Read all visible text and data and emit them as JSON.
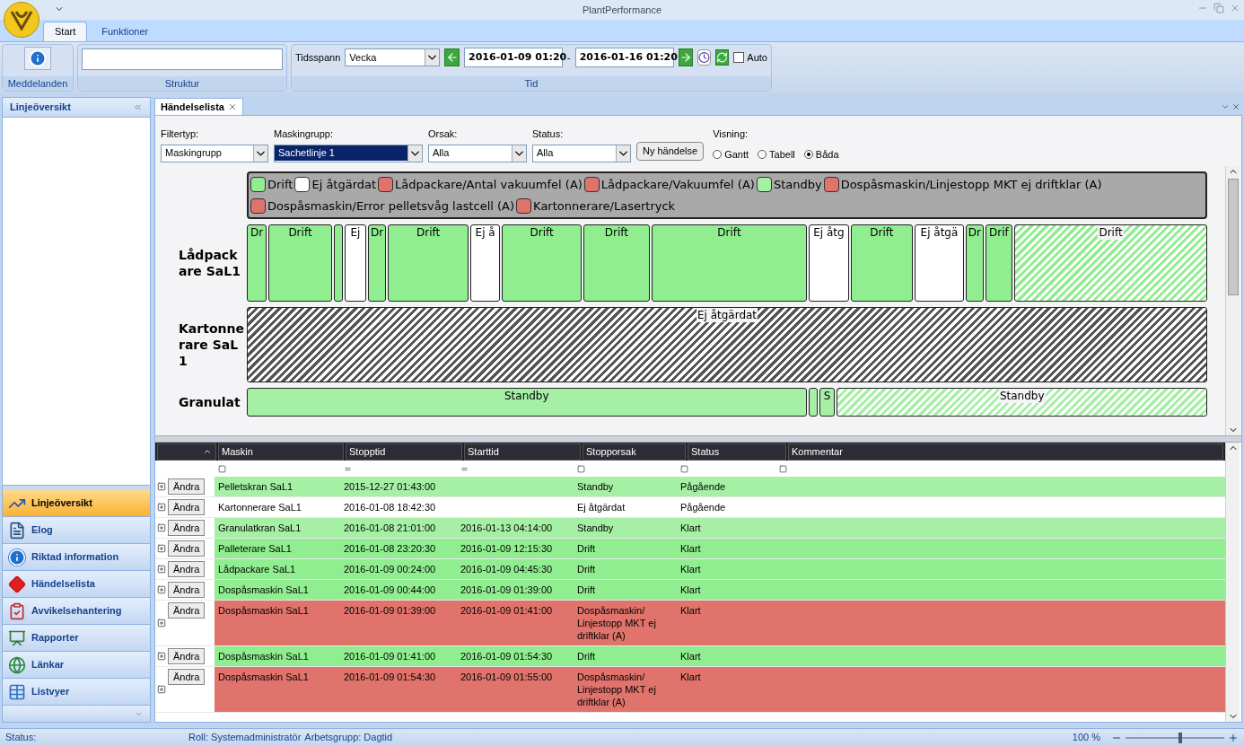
{
  "window": {
    "title": "PlantPerformance"
  },
  "ribbon": {
    "tabs": [
      {
        "label": "Start",
        "selected": true
      },
      {
        "label": "Funktioner",
        "selected": false
      }
    ],
    "messages_button": "Meddelanden",
    "structure_caption": "Struktur",
    "time": {
      "caption": "Tid",
      "span_label": "Tidsspann",
      "span_value": "Vecka",
      "from": "2016-01-09 01:20",
      "separator": "-",
      "to": "2016-01-16 01:20",
      "auto": {
        "label": "Auto",
        "checked": false
      }
    }
  },
  "sidebar": {
    "title": "Linjeöversikt",
    "items": [
      {
        "label": "Linjeöversikt",
        "selected": true
      },
      {
        "label": "Elog",
        "selected": false
      },
      {
        "label": "Riktad information",
        "selected": false
      },
      {
        "label": "Händelselista",
        "selected": false
      },
      {
        "label": "Avvikelsehantering",
        "selected": false
      },
      {
        "label": "Rapporter",
        "selected": false
      },
      {
        "label": "Länkar",
        "selected": false
      },
      {
        "label": "Listvyer",
        "selected": false
      }
    ]
  },
  "document_tab": {
    "label": "Händelselista"
  },
  "filters": [
    {
      "label": "Filtertyp:",
      "value": "Maskingrupp",
      "highlighted": false
    },
    {
      "label": "Maskingrupp:",
      "value": "Sachetlinje 1",
      "highlighted": true
    },
    {
      "label": "Orsak:",
      "value": "Alla",
      "highlighted": false
    },
    {
      "label": "Status:",
      "value": "Alla",
      "highlighted": false
    }
  ],
  "new_event_button": "Ny händelse",
  "view": {
    "label": "Visning:",
    "options": [
      {
        "label": "Gantt",
        "selected": false
      },
      {
        "label": "Tabell",
        "selected": false
      },
      {
        "label": "Båda",
        "selected": true
      }
    ]
  },
  "legend": [
    {
      "label": "Drift",
      "color": "#90ee90"
    },
    {
      "label": "Ej åtgärdat",
      "color": "#ffffff"
    },
    {
      "label": "Lådpackare/Antal vakuumfel (A)",
      "color": "#e0736b"
    },
    {
      "label": "Lådpackare/Vakuumfel (A)",
      "color": "#e0736b"
    },
    {
      "label": "Standby",
      "color": "#a6f0a6"
    },
    {
      "label": "Dospåsmaskin/Linjestopp MKT ej driftklar (A)",
      "color": "#e0736b"
    },
    {
      "label": "Dospåsmaskin/Error pelletsvåg lastcell (A)",
      "color": "#e0736b"
    },
    {
      "label": "Kartonnerare/Lasertryck",
      "color": "#e0736b"
    }
  ],
  "gantt": {
    "rows": [
      {
        "name": "Lådpackare SaL1",
        "segments": [
          {
            "label": "Dr",
            "kind": "solid",
            "color": "#90ee90"
          },
          {
            "label": "Drift",
            "kind": "solid",
            "color": "#90ee90"
          },
          {
            "kind": "solid",
            "color": "#90ee90"
          },
          {
            "label": "Ej",
            "kind": "solid",
            "color": "#ffffff"
          },
          {
            "label": "Dr",
            "kind": "solid",
            "color": "#90ee90"
          },
          {
            "label": "Drift",
            "kind": "solid",
            "color": "#90ee90"
          },
          {
            "label": "Ej å",
            "kind": "solid",
            "color": "#ffffff"
          },
          {
            "label": "Drift",
            "kind": "solid",
            "color": "#90ee90"
          },
          {
            "label": "Drift",
            "kind": "solid",
            "color": "#90ee90"
          },
          {
            "label": "Drift",
            "kind": "solid",
            "color": "#90ee90"
          },
          {
            "label": "Ej åtg",
            "kind": "solid",
            "color": "#ffffff"
          },
          {
            "label": "Drift",
            "kind": "solid",
            "color": "#90ee90"
          },
          {
            "label": "Ej åtgä",
            "kind": "solid",
            "color": "#ffffff"
          },
          {
            "label": "Dr",
            "kind": "solid",
            "color": "#90ee90"
          },
          {
            "label": "Drif",
            "kind": "solid",
            "color": "#90ee90"
          },
          {
            "label": "Drift",
            "kind": "hatched",
            "color": "#90ee90"
          }
        ]
      },
      {
        "name": "Kartonnerare SaL1",
        "segments": [
          {
            "label": "Ej åtgärdat",
            "kind": "hatched",
            "color": "#555555"
          }
        ]
      },
      {
        "name": "Granulat",
        "segments": [
          {
            "label": "Standby",
            "kind": "solid",
            "color": "#a6f0a6"
          },
          {
            "kind": "solid",
            "color": "#a6f0a6"
          },
          {
            "label": "S",
            "kind": "solid",
            "color": "#a6f0a6"
          },
          {
            "label": "Standby",
            "kind": "hatched",
            "color": "#a6f0a6"
          }
        ]
      }
    ]
  },
  "table": {
    "columns": [
      "Maskin",
      "Stopptid",
      "Starttid",
      "Stopporsak",
      "Status",
      "Kommentar"
    ],
    "filter_row": [
      {
        "kind": "box"
      },
      {
        "kind": "equals"
      },
      {
        "kind": "equals"
      },
      {
        "kind": "box"
      },
      {
        "kind": "box"
      },
      {
        "kind": "box"
      }
    ],
    "rows": [
      {
        "edit": "Ändra",
        "machine": "Pelletskran SaL1",
        "stop": "2015-12-27 01:43:00",
        "cause": "Standby",
        "status": "Pågående",
        "color": "#a6f0a6"
      },
      {
        "edit": "Ändra",
        "machine": "Kartonnerare SaL1",
        "stop": "2016-01-08 18:42:30",
        "cause": "Ej åtgärdat",
        "status": "Pågående",
        "color": "#ffffff"
      },
      {
        "edit": "Ändra",
        "machine": "Granulatkran SaL1",
        "stop": "2016-01-08 21:01:00",
        "start": "2016-01-13 04:14:00",
        "cause": "Standby",
        "status": "Klart",
        "color": "#a6f0a6"
      },
      {
        "edit": "Ändra",
        "machine": "Palleterare SaL1",
        "stop": "2016-01-08 23:20:30",
        "start": "2016-01-09 12:15:30",
        "cause": "Drift",
        "status": "Klart",
        "color": "#90ee90"
      },
      {
        "edit": "Ändra",
        "machine": "Lådpackare SaL1",
        "stop": "2016-01-09 00:24:00",
        "start": "2016-01-09 04:45:30",
        "cause": "Drift",
        "status": "Klart",
        "color": "#90ee90"
      },
      {
        "edit": "Ändra",
        "machine": "Dospåsmaskin SaL1",
        "stop": "2016-01-09 00:44:00",
        "start": "2016-01-09 01:39:00",
        "cause": "Drift",
        "status": "Klart",
        "color": "#90ee90"
      },
      {
        "edit": "Ändra",
        "machine": "Dospåsmaskin SaL1",
        "stop": "2016-01-09 01:39:00",
        "start": "2016-01-09 01:41:00",
        "cause": "Dospåsmaskin/ Linjestopp MKT ej driftklar (A)",
        "status": "Klart",
        "color": "#e0736b"
      },
      {
        "edit": "Ändra",
        "machine": "Dospåsmaskin SaL1",
        "stop": "2016-01-09 01:41:00",
        "start": "2016-01-09 01:54:30",
        "cause": "Drift",
        "status": "Klart",
        "color": "#90ee90"
      },
      {
        "edit": "Ändra",
        "machine": "Dospåsmaskin SaL1",
        "stop": "2016-01-09 01:54:30",
        "start": "2016-01-09 01:55:00",
        "cause": "Dospåsmaskin/ Linjestopp MKT ej driftklar (A)",
        "status": "Klart",
        "color": "#e0736b"
      }
    ]
  },
  "status_bar": {
    "status": "Status:",
    "role": "Roll: Systemadministratör",
    "workgroup": "Arbetsgrupp: Dagtid",
    "zoom": "100 %",
    "zoom_slider": {
      "level": 0.55
    }
  }
}
